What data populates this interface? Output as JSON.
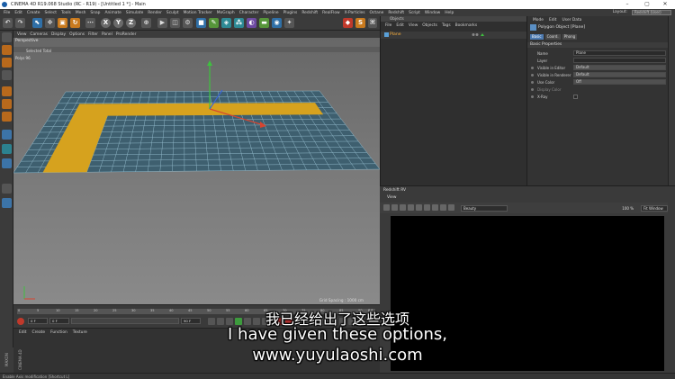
{
  "window": {
    "title": "CINEMA 4D R19.068 Studio (RC - R19) - [Untitled 1 *] - Main",
    "controls": {
      "minimize": "–",
      "maximize": "▢",
      "close": "✕"
    }
  },
  "menubar": {
    "items": [
      "File",
      "Edit",
      "Create",
      "Select",
      "Tools",
      "Mesh",
      "Snap",
      "Animate",
      "Simulate",
      "Render",
      "Sculpt",
      "Motion Tracker",
      "MoGraph",
      "Character",
      "Pipeline",
      "Plugins",
      "Redshift",
      "RealFlow",
      "X-Particles",
      "Octane",
      "Redshift",
      "Script",
      "Window",
      "Help"
    ],
    "layout_label": "Layout:",
    "layout_value": "Redshift (User)"
  },
  "toolbar": {
    "axis_labels": [
      "X",
      "Y",
      "Z"
    ]
  },
  "viewport": {
    "menu": [
      "View",
      "Cameras",
      "Display",
      "Options",
      "Filter",
      "Panel",
      "ProRender"
    ],
    "label": "Perspective",
    "stats_title": "Selected Total",
    "stats_polys": "Polys  96",
    "grid_spacing": "Grid Spacing : 1000 cm",
    "grid": {
      "plane_color": "#3e5f6f",
      "line_color": "#8fb7c8",
      "selection_color": "#d6a21e"
    }
  },
  "timeline": {
    "ticks": [
      "0",
      "5",
      "10",
      "15",
      "20",
      "25",
      "30",
      "35",
      "40",
      "45",
      "50",
      "55",
      "60",
      "65",
      "70",
      "75",
      "80",
      "85",
      "90"
    ],
    "end_marker": "0 F",
    "start_field": "0 F",
    "current_field": "0 F",
    "end_field": "90 F",
    "max_field": "90 F"
  },
  "material_manager": {
    "menu": [
      "Edit",
      "Create",
      "Function",
      "Texture"
    ]
  },
  "statusbar": {
    "text": "Enable Axis modification [Shortcut L]"
  },
  "side_logo": "MAXON CINEMA 4D",
  "object_manager": {
    "title": "Objects",
    "menu": [
      "File",
      "Edit",
      "View",
      "Objects",
      "Tags",
      "Bookmarks"
    ],
    "objects": [
      {
        "name": "Plane"
      }
    ]
  },
  "attribute_manager": {
    "menu": [
      "Mode",
      "Edit",
      "User Data"
    ],
    "object_title": "Polygon Object [Plane]",
    "tabs": [
      {
        "label": "Basic",
        "active": true
      },
      {
        "label": "Coord.",
        "active": false
      },
      {
        "label": "Phong",
        "active": false
      }
    ],
    "section": "Basic Properties",
    "rows": [
      {
        "label": "Name",
        "value": "Plane"
      },
      {
        "label": "Layer",
        "value": ""
      },
      {
        "label": "Visible in Editor",
        "value": "Default"
      },
      {
        "label": "Visible in Renderer",
        "value": "Default"
      },
      {
        "label": "Use Color",
        "value": "Off"
      },
      {
        "label": "Display Color",
        "value": ""
      },
      {
        "label": "X-Ray",
        "value": ""
      }
    ]
  },
  "redshift": {
    "title": "Redshift RV",
    "menu": "View",
    "aov": "Beauty",
    "zoom": "100 %",
    "fit": "Fit Window"
  },
  "subtitles": {
    "zh": "我已经给出了这些选项",
    "en": "I have given these options,",
    "url": "www.yuyulaoshi.com"
  }
}
